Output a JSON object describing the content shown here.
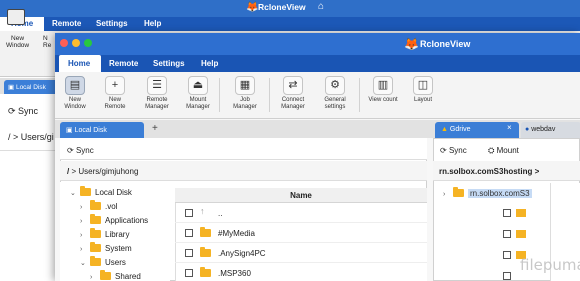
{
  "app": {
    "title": "RcloneView"
  },
  "menu": {
    "home": "Home",
    "remote": "Remote",
    "settings": "Settings",
    "help": "Help"
  },
  "background_window": {
    "new_window": "New\nWindow",
    "new_remote_partial": "N\nRe",
    "tab_local_disk": "Local Disk",
    "sync": "Sync",
    "path": "/ > Users/gi"
  },
  "toolbar": {
    "new_window": "New\nWindow",
    "new_remote": "New\nRemote",
    "remote_manager": "Remote\nManager",
    "mount_manager": "Mount\nManager",
    "job_manager": "Job\nManager",
    "connect_manager": "Connect\nManager",
    "general_settings": "General\nsettings",
    "view_count": "View count",
    "layout": "Layout"
  },
  "tabs": {
    "local_disk": "Local Disk",
    "add": "+",
    "gdrive": "Gdrive",
    "gdrive_close": "×",
    "webdav": "webdav"
  },
  "left": {
    "sync": "Sync",
    "path_prefix": "/",
    "path_sep": ">",
    "path": "Users/gimjuhong",
    "tree": [
      {
        "label": "Local Disk",
        "chevron": "⌄"
      },
      {
        "label": ".vol",
        "chevron": "›"
      },
      {
        "label": "Applications",
        "chevron": "›"
      },
      {
        "label": "Library",
        "chevron": "›"
      },
      {
        "label": "System",
        "chevron": "›"
      },
      {
        "label": "Users",
        "chevron": "⌄"
      },
      {
        "label": "Shared",
        "chevron": "›"
      }
    ],
    "column_header": "Name",
    "files": [
      {
        "name": "..",
        "kind": "up"
      },
      {
        "name": "#MyMedia",
        "kind": "folder"
      },
      {
        "name": ".AnySign4PC",
        "kind": "folder"
      },
      {
        "name": ".MSP360",
        "kind": "folder"
      }
    ]
  },
  "right": {
    "sync": "Sync",
    "mount": "Mount",
    "path": "rn.solbox.comS3hosting",
    "path_sep": ">",
    "tree_item": "rn.solbox.comS3"
  },
  "watermark": "filepuma",
  "colors": {
    "title_bar": "#2e6fd0",
    "menu_bar": "#1a55b4",
    "tab_active": "#3b7ed6",
    "folder": "#f5b324"
  }
}
